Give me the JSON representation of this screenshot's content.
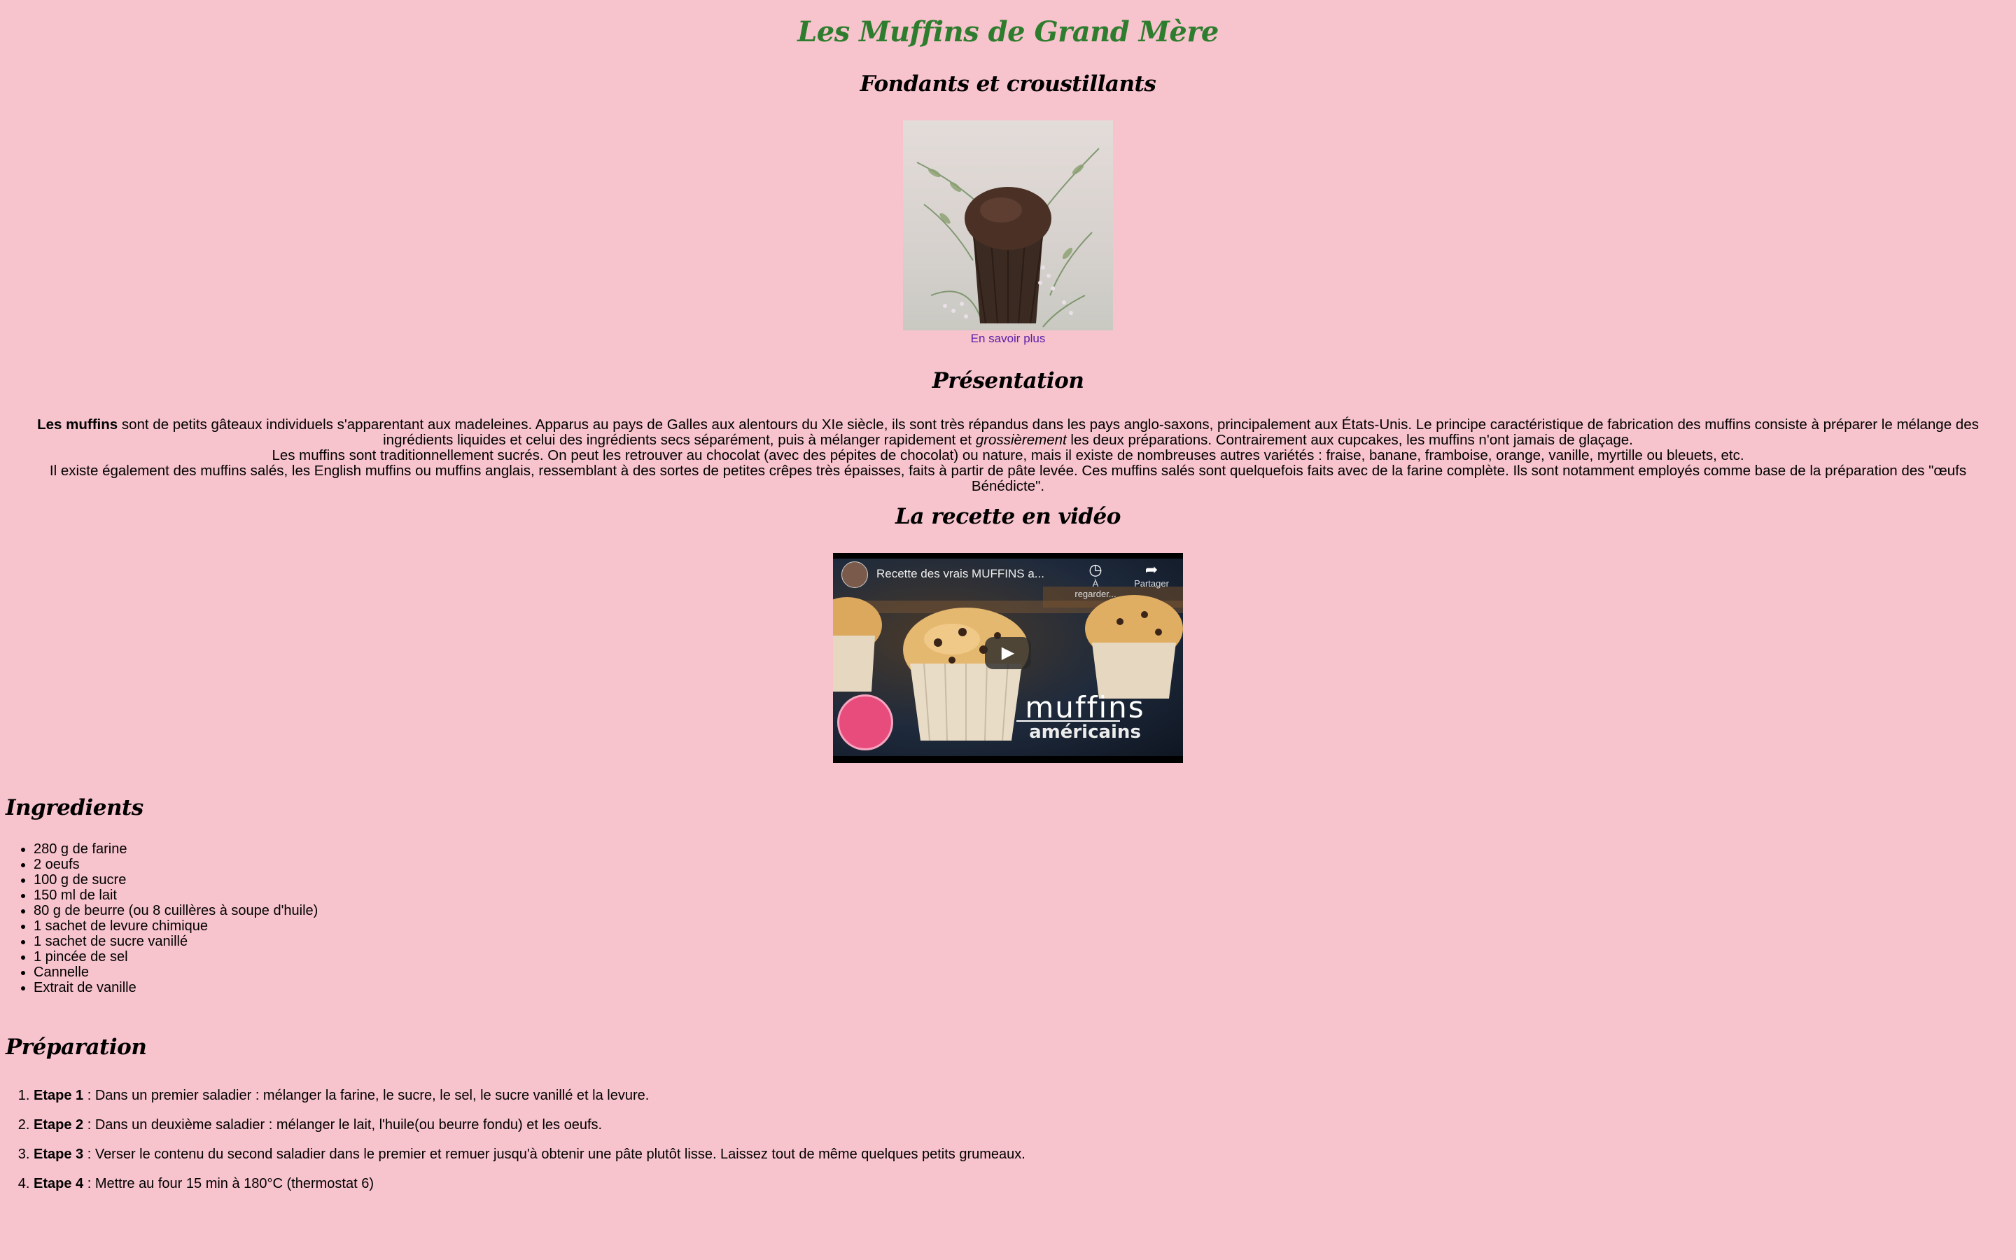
{
  "header": {
    "title": "Les Muffins de Grand Mère",
    "subtitle": "Fondants et croustillants"
  },
  "hero": {
    "image_alt": "muffin au chocolat",
    "link_label": "En savoir plus"
  },
  "presentation": {
    "heading": "Présentation",
    "p1_bold": "Les muffins",
    "p1_rest_a": " sont de petits gâteaux individuels s'apparentant aux madeleines. Apparus au pays de Galles aux alentours du XIe siècle, ils sont très répandus dans les pays anglo-saxons, principalement aux États-Unis. Le principe caractéristique de fabrication des muffins consiste à préparer le mélange des ingrédients liquides et celui des ingrédients secs séparément, puis à mélanger rapidement et ",
    "p1_italic": "grossièrement",
    "p1_rest_b": " les deux préparations. Contrairement aux cupcakes, les muffins n'ont jamais de glaçage.",
    "p2": "Les muffins sont traditionnellement sucrés. On peut les retrouver au chocolat (avec des pépites de chocolat) ou nature, mais il existe de nombreuses autres variétés : fraise, banane, framboise, orange, vanille, myrtille ou bleuets, etc.",
    "p3": "Il existe également des muffins salés, les English muffins ou muffins anglais, ressemblant à des sortes de petites crêpes très épaisses, faits à partir de pâte levée. Ces muffins salés sont quelquefois faits avec de la farine complète. Ils sont notamment employés comme base de la préparation des \"œufs Bénédicte\"."
  },
  "video_section": {
    "heading": "La recette en vidéo",
    "video_title": "Recette des vrais MUFFINS a...",
    "watch_later": "À regarder...",
    "share": "Partager",
    "brand_big": "muffins",
    "brand_small": "américains"
  },
  "ingredients": {
    "heading": "Ingredients",
    "items": [
      "280 g de farine",
      "2 oeufs",
      "100 g de sucre",
      "150 ml de lait",
      "80 g de beurre (ou 8 cuillères à soupe d'huile)",
      "1 sachet de levure chimique",
      "1 sachet de sucre vanillé",
      "1 pincée de sel",
      "Cannelle",
      "Extrait de vanille"
    ]
  },
  "preparation": {
    "heading": "Préparation",
    "steps": [
      {
        "label": "Etape 1",
        "text": " : Dans un premier saladier : mélanger la farine, le sucre, le sel, le sucre vanillé et la levure."
      },
      {
        "label": "Etape 2",
        "text": " : Dans un deuxième saladier : mélanger le lait, l'huile(ou beurre fondu) et les oeufs."
      },
      {
        "label": "Etape 3",
        "text": " : Verser le contenu du second saladier dans le premier et remuer jusqu'à obtenir une pâte plutôt lisse. Laissez tout de même quelques petits grumeaux."
      },
      {
        "label": "Etape 4",
        "text": " : Mettre au four 15 min à 180°C (thermostat 6)"
      }
    ]
  },
  "colors": {
    "background": "#f7c3cd",
    "title_green": "#2e7d2e",
    "link_purple": "#5a1fa8"
  }
}
